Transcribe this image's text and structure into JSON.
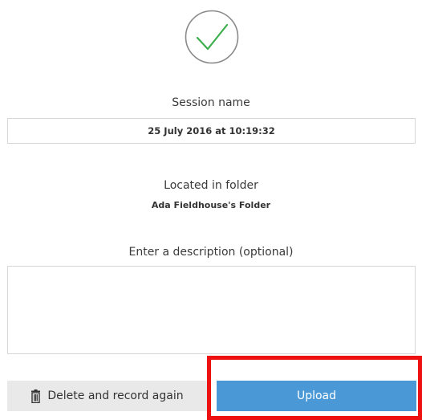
{
  "status": {
    "icon": "check-circle-icon",
    "icon_color": "#3dae4d"
  },
  "session": {
    "label": "Session name",
    "value": "25 July 2016 at 10:19:32"
  },
  "folder": {
    "label": "Located in folder",
    "name": "Ada Fieldhouse's Folder"
  },
  "description": {
    "label": "Enter a description (optional)",
    "value": "",
    "placeholder": ""
  },
  "actions": {
    "delete_label": "Delete and record again",
    "delete_icon": "trash-icon",
    "upload_label": "Upload",
    "upload_color": "#4a99d6",
    "highlight_color": "#ee1111"
  }
}
